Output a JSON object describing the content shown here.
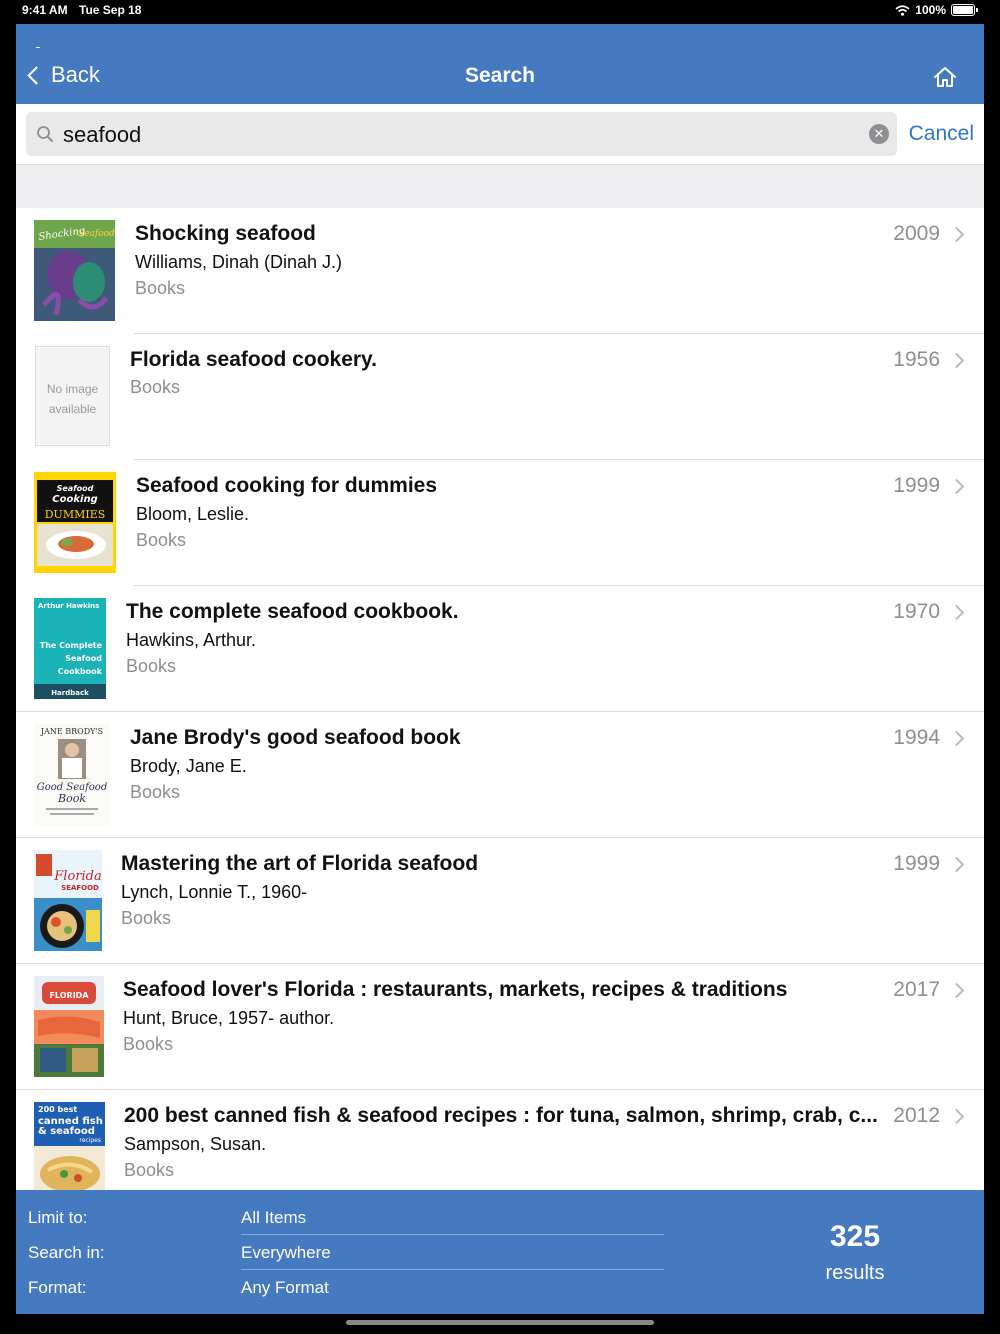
{
  "status_bar": {
    "time": "9:41 AM",
    "date": "Tue Sep 18",
    "battery": "100%"
  },
  "nav": {
    "back_label": "Back",
    "title": "Search"
  },
  "search": {
    "value": "seafood",
    "cancel_label": "Cancel"
  },
  "results": [
    {
      "title": "Shocking seafood",
      "author": "Williams, Dinah (Dinah J.)",
      "kind": "Books",
      "year": "2009",
      "cover": "shocking"
    },
    {
      "title": "Florida seafood cookery.",
      "author": "",
      "kind": "Books",
      "year": "1956",
      "cover": "none"
    },
    {
      "title": "Seafood cooking for dummies",
      "author": "Bloom, Leslie.",
      "kind": "Books",
      "year": "1999",
      "cover": "dummies"
    },
    {
      "title": "The complete seafood cookbook.",
      "author": "Hawkins, Arthur.",
      "kind": "Books",
      "year": "1970",
      "cover": "complete"
    },
    {
      "title": "Jane Brody's good seafood book",
      "author": "Brody, Jane E.",
      "kind": "Books",
      "year": "1994",
      "cover": "brody"
    },
    {
      "title": "Mastering the art of Florida seafood",
      "author": "Lynch, Lonnie T., 1960-",
      "kind": "Books",
      "year": "1999",
      "cover": "mastering"
    },
    {
      "title": "Seafood lover's Florida : restaurants, markets, recipes & traditions",
      "author": "Hunt, Bruce, 1957- author.",
      "kind": "Books",
      "year": "2017",
      "cover": "lover"
    },
    {
      "title": "200 best canned fish & seafood recipes : for tuna, salmon, shrimp, crab, c...",
      "author": "Sampson, Susan.",
      "kind": "Books",
      "year": "2012",
      "cover": "canned"
    }
  ],
  "covers": {
    "none": [
      "No image",
      "available"
    ],
    "dummies": [
      "Seafood",
      "Cooking",
      "DUMMIES"
    ],
    "complete": [
      "Arthur Hawkins",
      "The Complete",
      "Seafood",
      "Cookbook",
      "Hardback"
    ],
    "brody": [
      "JANE BRODY'S",
      "Good Seafood",
      "Book"
    ],
    "mastering": [
      "Florida",
      "SEAFOOD"
    ],
    "lover": [
      "FLORIDA"
    ],
    "canned": [
      "200 best",
      "canned fish",
      "& seafood",
      "recipes"
    ]
  },
  "filters": [
    {
      "label": "Limit to:",
      "value": "All Items"
    },
    {
      "label": "Search in:",
      "value": "Everywhere"
    },
    {
      "label": "Format:",
      "value": "Any Format"
    }
  ],
  "result_count": {
    "number": "325",
    "label": "results"
  },
  "colors": {
    "bar": "#4579c0",
    "link": "#2b77d0"
  }
}
